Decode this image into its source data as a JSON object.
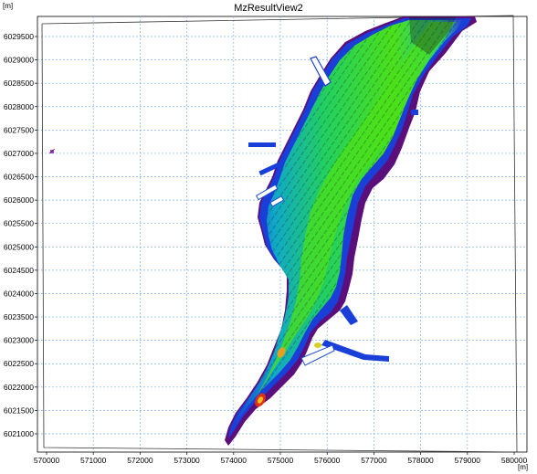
{
  "window": {
    "title": "MzResultView2"
  },
  "axes": {
    "x_unit": "[m]",
    "y_unit": "[m]",
    "x_ticks": [
      "570000",
      "571000",
      "572000",
      "573000",
      "574000",
      "575000",
      "576000",
      "577000",
      "578000",
      "579000",
      "580000"
    ],
    "y_ticks": [
      "6029500",
      "6029000",
      "6028500",
      "6028000",
      "6027500",
      "6027000",
      "6026500",
      "6026000",
      "6025500",
      "6025000",
      "6024500",
      "6024000",
      "6023500",
      "6023000",
      "6022500",
      "6022000",
      "6021500",
      "6021000"
    ]
  },
  "colors": {
    "grid": "#7ab0ea",
    "deep": "#5a0f7a",
    "low": "#1a3fd8",
    "mid": "#00c8a0",
    "high": "#4be01a",
    "peak": "#e03010",
    "arrows": "#1a1a1a"
  }
}
